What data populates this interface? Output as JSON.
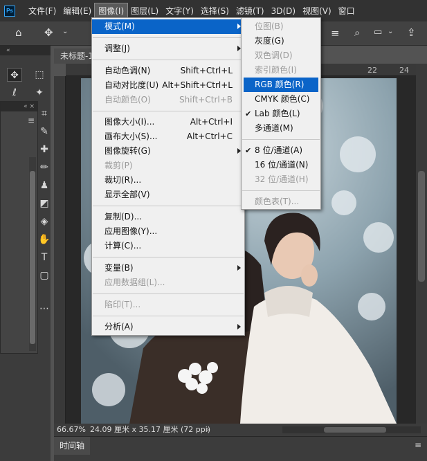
{
  "menubar": {
    "app_logo": "Ps",
    "items": [
      "文件(F)",
      "编辑(E)",
      "图像(I)",
      "图层(L)",
      "文字(Y)",
      "选择(S)",
      "滤镜(T)",
      "3D(D)",
      "视图(V)",
      "窗口"
    ]
  },
  "panel": {
    "collapse_glyph": "«",
    "expand_glyph": "«",
    "subpanel_glyph": "« ×"
  },
  "document": {
    "tab_title": "未标题-1"
  },
  "ruler": {
    "ticks": [
      "22",
      "24"
    ]
  },
  "status": {
    "zoom": "66.67%",
    "doc_info": "24.09 厘米 x 35.17 厘米 (72 ppi)",
    "arrow": "›"
  },
  "timeline": {
    "tab_label": "时间轴"
  },
  "image_menu": {
    "mode": "模式(M)",
    "adjust": "调整(J)",
    "auto_tone": "自动色调(N)",
    "auto_tone_sc": "Shift+Ctrl+L",
    "auto_contrast": "自动对比度(U)",
    "auto_contrast_sc": "Alt+Shift+Ctrl+L",
    "auto_color": "自动颜色(O)",
    "auto_color_sc": "Shift+Ctrl+B",
    "image_size": "图像大小(I)...",
    "image_size_sc": "Alt+Ctrl+I",
    "canvas_size": "画布大小(S)...",
    "canvas_size_sc": "Alt+Ctrl+C",
    "image_rotation": "图像旋转(G)",
    "crop": "裁剪(P)",
    "trim": "裁切(R)...",
    "reveal_all": "显示全部(V)",
    "duplicate": "复制(D)...",
    "apply_image": "应用图像(Y)...",
    "calculations": "计算(C)...",
    "variables": "变量(B)",
    "apply_data_set": "应用数据组(L)...",
    "trap": "陷印(T)...",
    "analysis": "分析(A)"
  },
  "mode_menu": {
    "bitmap": "位图(B)",
    "grayscale": "灰度(G)",
    "duotone": "双色调(D)",
    "indexed": "索引颜色(I)",
    "rgb": "RGB 颜色(R)",
    "cmyk": "CMYK 颜色(C)",
    "lab": "Lab 颜色(L)",
    "multichannel": "多通道(M)",
    "bits8": "8 位/通道(A)",
    "bits16": "16 位/通道(N)",
    "bits32": "32 位/通道(H)",
    "color_table": "颜色表(T)...",
    "check": "✔"
  },
  "colors": {
    "accent": "#0a64c8",
    "menubar_bg": "#323232",
    "canvas_bg": "#282828"
  }
}
